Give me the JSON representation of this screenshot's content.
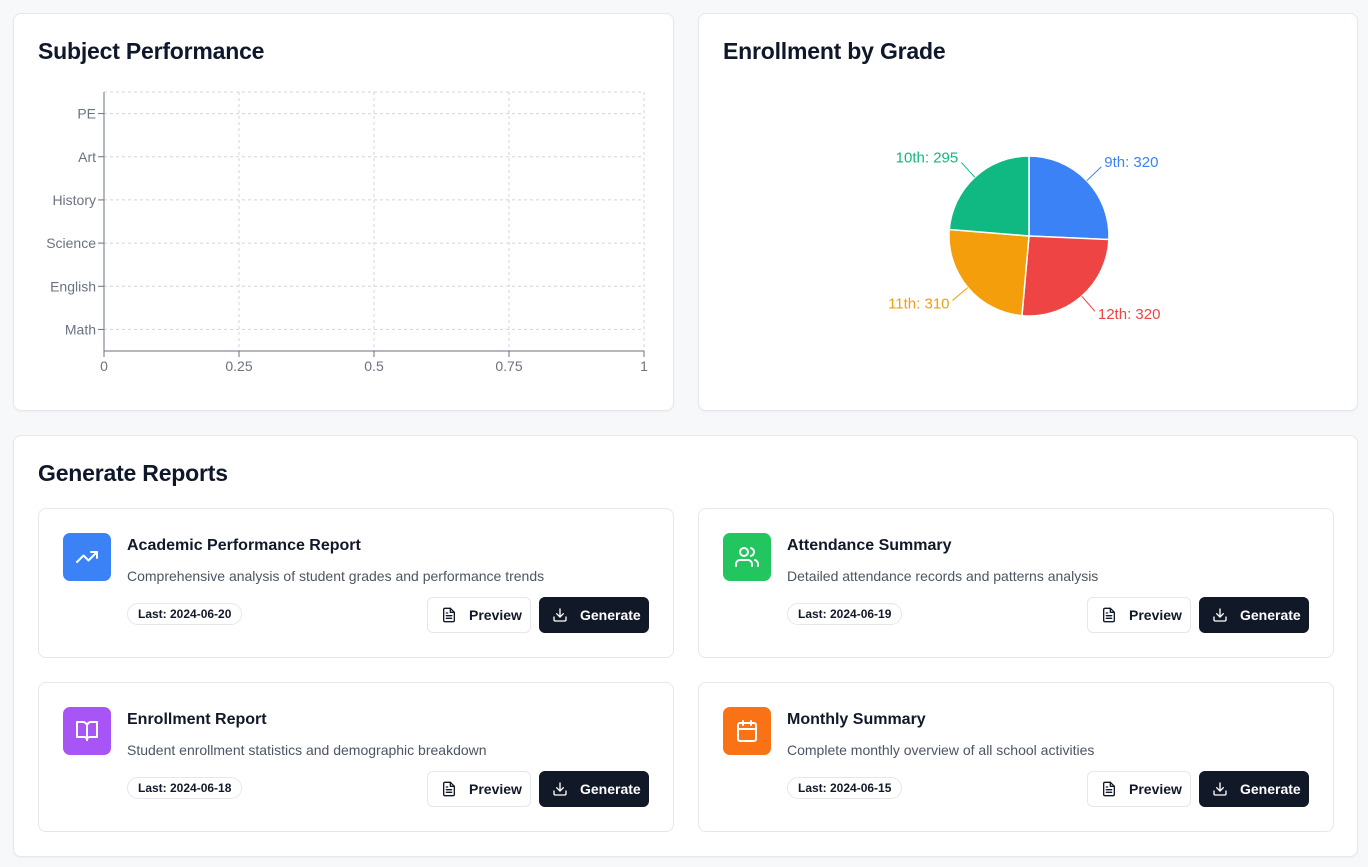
{
  "performance": {
    "title": "Subject Performance",
    "chart_data": {
      "type": "bar",
      "orientation": "horizontal",
      "categories": [
        "Math",
        "English",
        "Science",
        "History",
        "Art",
        "PE"
      ],
      "values": [],
      "x_ticks": [
        "0",
        "0.25",
        "0.5",
        "0.75",
        "1"
      ],
      "xlim": [
        0,
        1
      ],
      "grid": true
    }
  },
  "enrollment": {
    "title": "Enrollment by Grade",
    "chart_data": {
      "type": "pie",
      "slices": [
        {
          "label": "9th: 320",
          "value": 320,
          "color": "#3b82f6"
        },
        {
          "label": "12th: 320",
          "value": 320,
          "color": "#ef4444"
        },
        {
          "label": "11th: 310",
          "value": 310,
          "color": "#f59e0b"
        },
        {
          "label": "10th: 295",
          "value": 295,
          "color": "#10b981"
        }
      ]
    }
  },
  "reports": {
    "title": "Generate Reports",
    "preview_label": "Preview",
    "generate_label": "Generate",
    "items": [
      {
        "title": "Academic Performance Report",
        "description": "Comprehensive analysis of student grades and performance trends",
        "last": "Last: 2024-06-20",
        "icon": "trending-up-icon",
        "color": "#3b82f6"
      },
      {
        "title": "Attendance Summary",
        "description": "Detailed attendance records and patterns analysis",
        "last": "Last: 2024-06-19",
        "icon": "users-icon",
        "color": "#22c55e"
      },
      {
        "title": "Enrollment Report",
        "description": "Student enrollment statistics and demographic breakdown",
        "last": "Last: 2024-06-18",
        "icon": "book-open-icon",
        "color": "#a855f7"
      },
      {
        "title": "Monthly Summary",
        "description": "Complete monthly overview of all school activities",
        "last": "Last: 2024-06-15",
        "icon": "calendar-icon",
        "color": "#f97316"
      }
    ]
  }
}
